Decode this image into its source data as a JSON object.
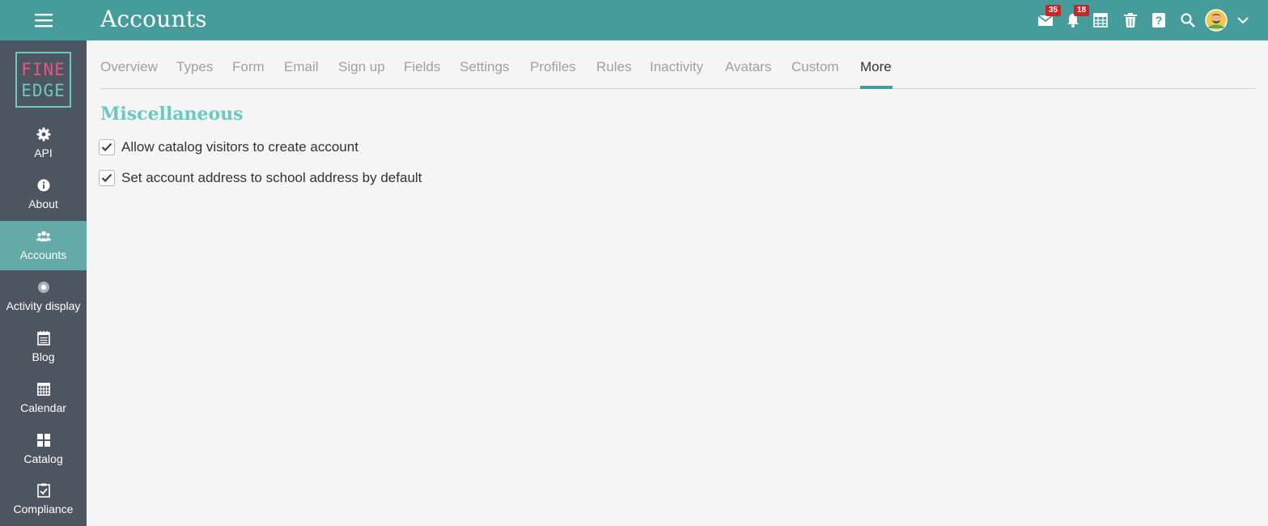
{
  "header": {
    "title": "Accounts",
    "messages_badge": "35",
    "notifications_badge": "18"
  },
  "sidebar": {
    "logo_line1": "FINE",
    "logo_line2": "EDGE",
    "items": [
      {
        "label": "API",
        "icon": "gear-icon"
      },
      {
        "label": "About",
        "icon": "info-icon"
      },
      {
        "label": "Accounts",
        "icon": "users-icon",
        "active": true
      },
      {
        "label": "Activity display",
        "icon": "radio-dot-icon"
      },
      {
        "label": "Blog",
        "icon": "notepad-icon"
      },
      {
        "label": "Calendar",
        "icon": "calendar-icon"
      },
      {
        "label": "Catalog",
        "icon": "grid-icon"
      },
      {
        "label": "Compliance",
        "icon": "clipboard-check-icon"
      }
    ]
  },
  "tabs": [
    "Overview",
    "Types",
    "Form",
    "Email",
    "Sign up",
    "Fields",
    "Settings",
    "Profiles",
    "Rules",
    "Inactivity",
    "Avatars",
    "Custom",
    "More"
  ],
  "active_tab": "More",
  "section": {
    "title": "Miscellaneous",
    "options": [
      {
        "label": "Allow catalog visitors to create account",
        "checked": true
      },
      {
        "label": "Set account address to school address by default",
        "checked": true
      }
    ]
  },
  "colors": {
    "header_bg": "#459c9a",
    "sidebar_bg": "#4d5660",
    "sidebar_active": "#64aaa6",
    "accent_title": "#6cc9bf",
    "badge": "#c62828"
  }
}
